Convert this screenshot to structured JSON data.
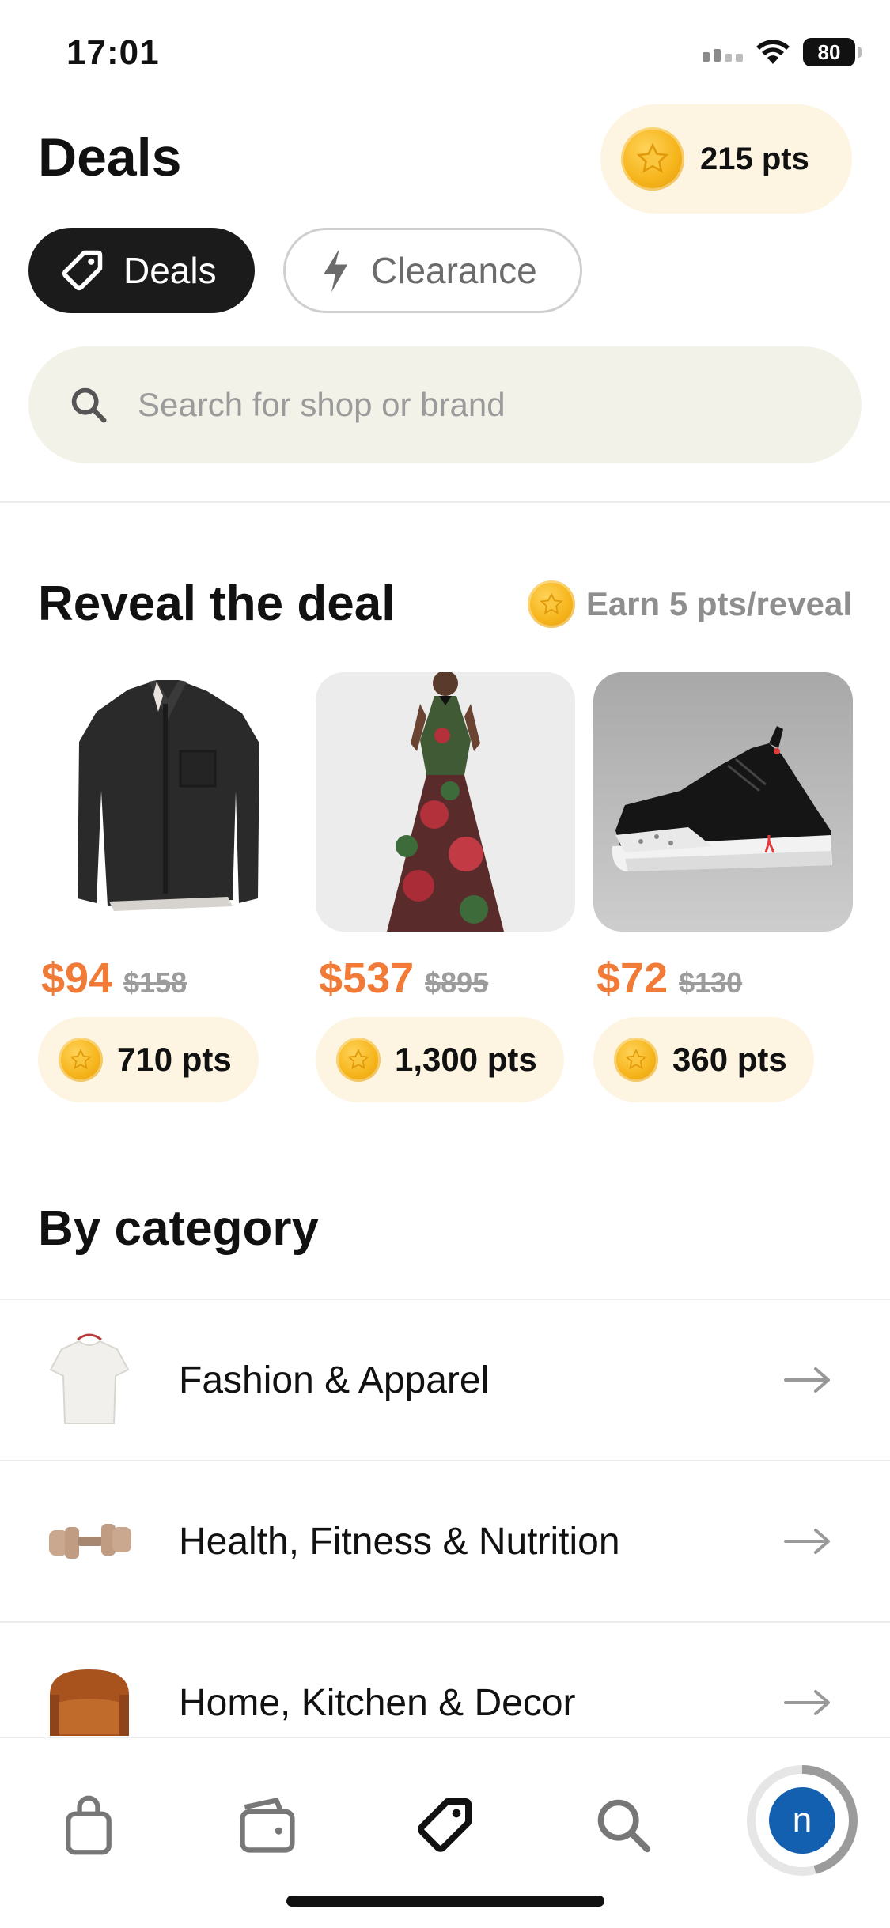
{
  "status_bar": {
    "time": "17:01",
    "battery": "80"
  },
  "header": {
    "title": "Deals",
    "points": "215 pts"
  },
  "tabs": [
    {
      "label": "Deals",
      "icon": "tag-icon",
      "active": true
    },
    {
      "label": "Clearance",
      "icon": "lightning-icon",
      "active": false
    }
  ],
  "search": {
    "placeholder": "Search for shop or brand"
  },
  "reveal": {
    "title": "Reveal the deal",
    "earn_label": "Earn 5 pts/reveal",
    "cards": [
      {
        "product": "black shirt",
        "price": "$94",
        "old_price": "$158",
        "points": "710 pts"
      },
      {
        "product": "floral dress",
        "price": "$537",
        "old_price": "$895",
        "points": "1,300 pts"
      },
      {
        "product": "sneaker",
        "price": "$72",
        "old_price": "$130",
        "points": "360 pts"
      }
    ]
  },
  "categories": {
    "title": "By category",
    "items": [
      {
        "label": "Fashion & Apparel",
        "icon": "tshirt-icon"
      },
      {
        "label": "Health, Fitness & Nutrition",
        "icon": "dumbbell-icon"
      },
      {
        "label": "Home, Kitchen & Decor",
        "icon": "armchair-icon"
      }
    ]
  },
  "bottom_nav": {
    "items": [
      "shopping-bag-icon",
      "wallet-icon",
      "tag-icon",
      "search-icon",
      "avatar"
    ],
    "avatar_initial": "n",
    "active": "tag-icon"
  },
  "colors": {
    "accent_price": "#f07a36",
    "points_bg": "#fdf5e2",
    "search_bg": "#f3f2e8",
    "avatar": "#1460b0"
  }
}
